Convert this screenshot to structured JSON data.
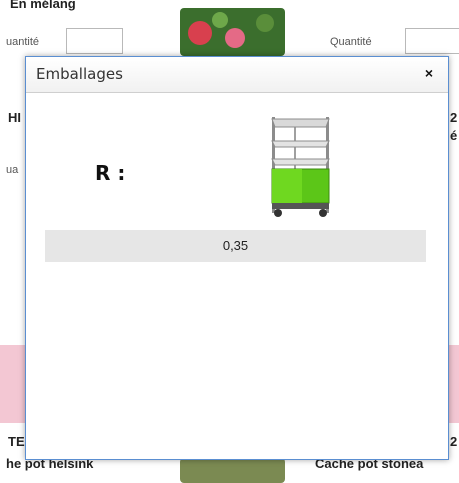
{
  "background": {
    "product_top_left": "En mélang",
    "quantity_label_left": "uantité",
    "quantity_label_right": "Quantité",
    "mid_left_text": "HI",
    "mid_left_small": "ua",
    "bottom_left_1": "TE",
    "bottom_left_2": "he pot helsink",
    "bottom_right_1": "2",
    "bottom_right_2": "Cache pot stonea",
    "right_edge_1": "2",
    "right_edge_2": "é"
  },
  "modal": {
    "title": "Emballages",
    "close_label": "×",
    "r_label": "R :",
    "value": "0,35",
    "icon": "trolley-cart-icon",
    "accent_color": "#5a8ed1"
  }
}
